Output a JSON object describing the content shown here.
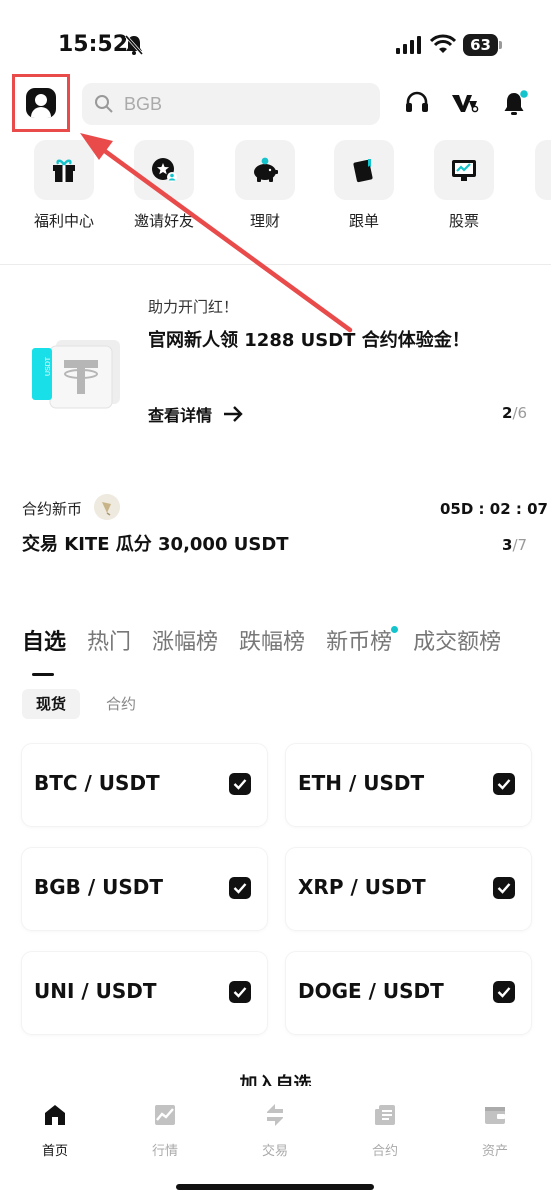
{
  "status_bar": {
    "time": "15:52",
    "battery": "63"
  },
  "header": {
    "search_placeholder": "BGB"
  },
  "quick_menu": [
    {
      "label": "福利中心",
      "icon": "gift-icon"
    },
    {
      "label": "邀请好友",
      "icon": "invite-friend-icon"
    },
    {
      "label": "理财",
      "icon": "piggy-bank-icon"
    },
    {
      "label": "跟单",
      "icon": "copy-trade-icon"
    },
    {
      "label": "股票",
      "icon": "stock-icon"
    }
  ],
  "banner": {
    "subtitle": "助力开门红！",
    "title": "官网新人领 1288 USDT 合约体验金！",
    "more_label": "查看详情",
    "page_current": "2",
    "page_total": "/6"
  },
  "promo": {
    "label": "合约新币",
    "countdown": "05D : 02 : 07",
    "title": "交易 KITE 瓜分 30,000 USDT",
    "page_current": "3",
    "page_total": "/7"
  },
  "tabs": [
    "自选",
    "热门",
    "涨幅榜",
    "跌幅榜",
    "新币榜",
    "成交额榜"
  ],
  "subtabs": [
    "现货",
    "合约"
  ],
  "pairs": [
    "BTC / USDT",
    "ETH / USDT",
    "BGB / USDT",
    "XRP / USDT",
    "UNI / USDT",
    "DOGE / USDT"
  ],
  "add_watchlist": "加入自选",
  "bottom_nav": [
    {
      "label": "首页",
      "icon": "home-icon"
    },
    {
      "label": "行情",
      "icon": "market-icon"
    },
    {
      "label": "交易",
      "icon": "trade-icon"
    },
    {
      "label": "合约",
      "icon": "contract-icon"
    },
    {
      "label": "资产",
      "icon": "wallet-icon"
    }
  ],
  "colors": {
    "accent": "#14c3cc",
    "highlight": "#e94b4b",
    "text": "#111111",
    "muted": "#9a9a9a"
  }
}
